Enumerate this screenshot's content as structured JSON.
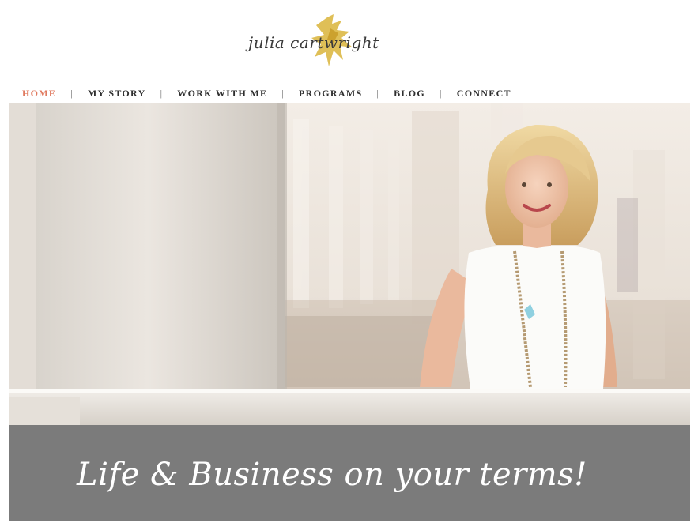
{
  "logo": {
    "text": "julia cartwright"
  },
  "nav": {
    "items": [
      {
        "label": "HOME",
        "active": true
      },
      {
        "label": "MY STORY",
        "active": false
      },
      {
        "label": "WORK WITH ME",
        "active": false
      },
      {
        "label": "PROGRAMS",
        "active": false
      },
      {
        "label": "BLOG",
        "active": false
      },
      {
        "label": "CONNECT",
        "active": false
      }
    ],
    "separator": "|"
  },
  "banner": {
    "tagline": "Life & Business on your terms!"
  },
  "colors": {
    "accent": "#e07a5f",
    "nav_text": "#2e2e2e",
    "banner_bg": "#7b7b7b",
    "logo_gold": "#d9b43a"
  }
}
